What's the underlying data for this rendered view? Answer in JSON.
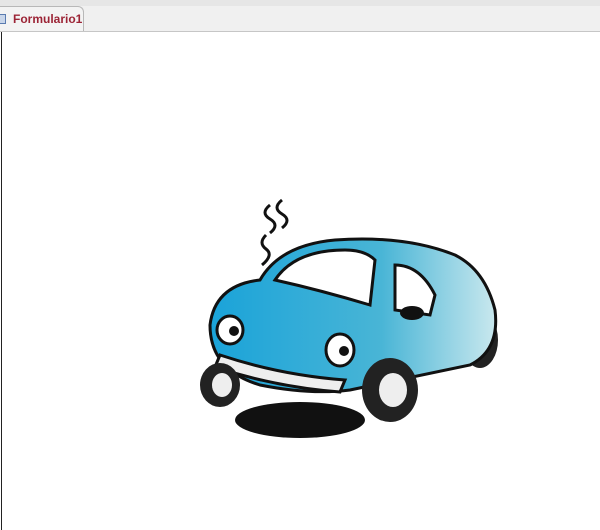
{
  "tab": {
    "label": "Formulario1",
    "icon": "form-icon"
  },
  "image": {
    "subject": "car-image"
  }
}
